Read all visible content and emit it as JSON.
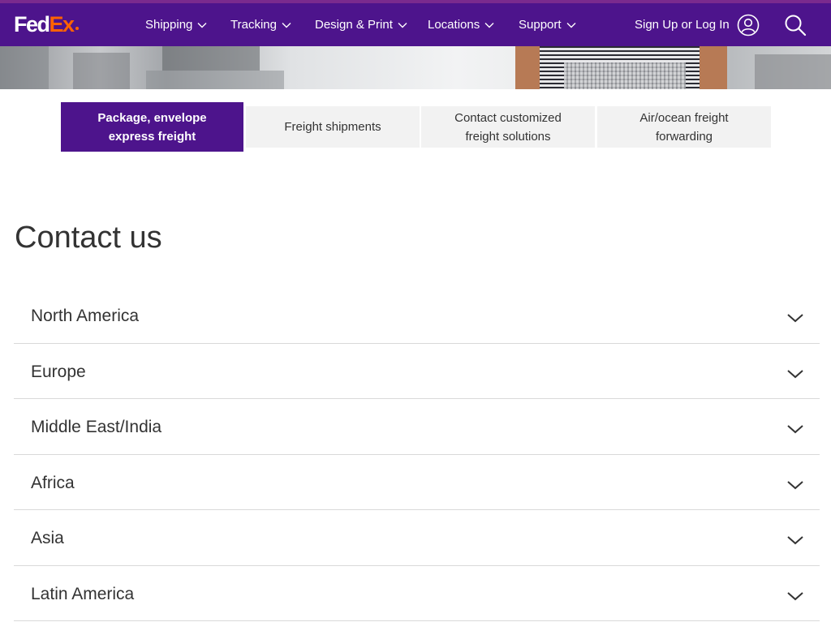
{
  "brand": {
    "logo_fed": "Fed",
    "logo_ex": "Ex",
    "primary_color": "#4d148c",
    "accent_color": "#ff6200"
  },
  "nav": {
    "items": [
      {
        "label": "Shipping",
        "icon": "chevron-down-icon"
      },
      {
        "label": "Tracking",
        "icon": "chevron-down-icon"
      },
      {
        "label": "Design & Print",
        "icon": "chevron-down-icon"
      },
      {
        "label": "Locations",
        "icon": "chevron-down-icon"
      },
      {
        "label": "Support",
        "icon": "chevron-down-icon"
      }
    ],
    "login_label": "Sign Up or Log In",
    "login_icon": "user-icon",
    "search_icon": "search-icon"
  },
  "tabs": [
    {
      "label": "Package, envelope express freight",
      "active": true
    },
    {
      "label": "Freight shipments",
      "active": false
    },
    {
      "label": "Contact customized freight solutions",
      "active": false
    },
    {
      "label": "Air/ocean freight forwarding",
      "active": false
    }
  ],
  "main": {
    "title": "Contact us",
    "regions": [
      {
        "label": "North America"
      },
      {
        "label": "Europe"
      },
      {
        "label": "Middle East/India"
      },
      {
        "label": "Africa"
      },
      {
        "label": "Asia"
      },
      {
        "label": "Latin America"
      }
    ]
  }
}
